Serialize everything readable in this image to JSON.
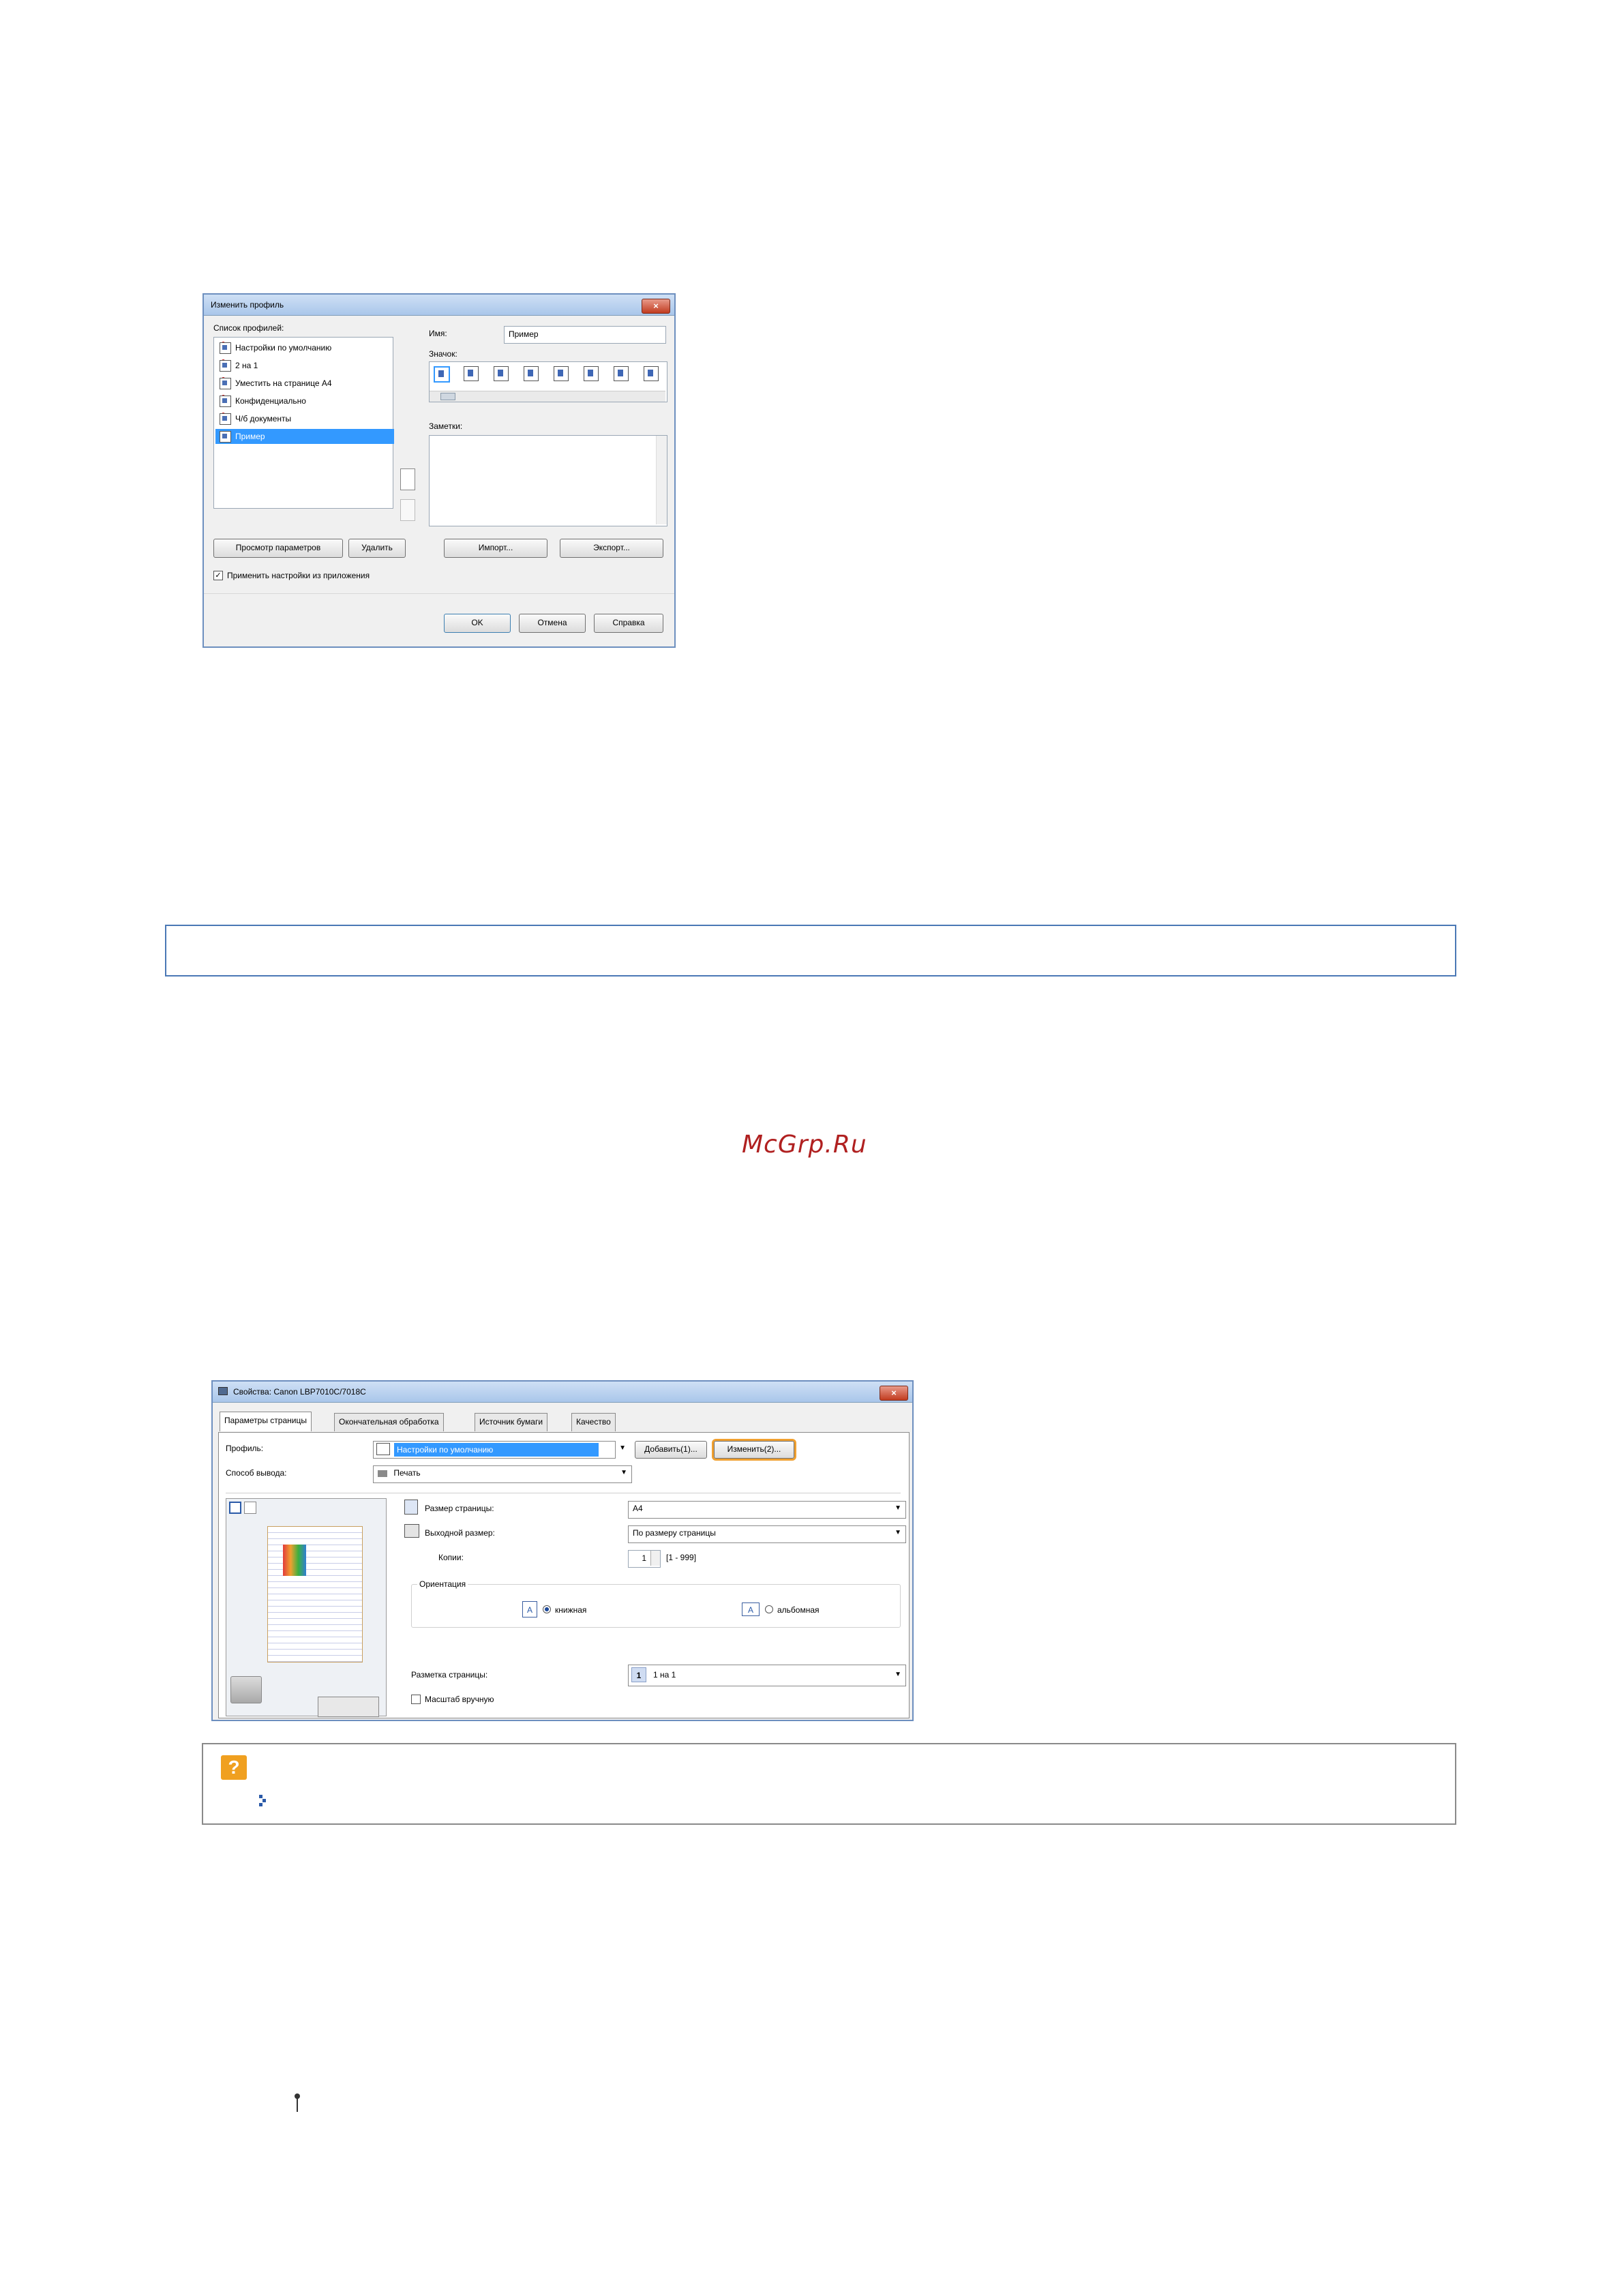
{
  "dialog1": {
    "title": "Изменить профиль",
    "close": "×",
    "profile_list_label": "Список профилей:",
    "profiles": [
      "Настройки по умолчанию",
      "2 на 1",
      "Уместить на странице A4",
      "Конфиденциально",
      "Ч/б документы",
      "Пример"
    ],
    "name_label": "Имя:",
    "name_value": "Пример",
    "icon_label": "Значок:",
    "notes_label": "Заметки:",
    "btn_view": "Просмотр параметров",
    "btn_delete": "Удалить",
    "btn_import": "Импорт...",
    "btn_export": "Экспорт...",
    "apply_checkbox": "Применить настройки из приложения",
    "btn_ok": "OK",
    "btn_cancel": "Отмена",
    "btn_help": "Справка"
  },
  "watermark": "McGrp.Ru",
  "dialog2": {
    "title": "Свойства: Canon LBP7010C/7018C",
    "close": "×",
    "tabs": [
      "Параметры страницы",
      "Окончательная обработка",
      "Источник бумаги",
      "Качество"
    ],
    "profile_label": "Профиль:",
    "profile_value": "Настройки по умолчанию",
    "btn_add": "Добавить(1)...",
    "btn_edit": "Изменить(2)...",
    "output_label": "Способ вывода:",
    "output_value": "Печать",
    "page_size_label": "Размер страницы:",
    "page_size_value": "A4",
    "output_size_label": "Выходной размер:",
    "output_size_value": "По размеру страницы",
    "copies_label": "Копии:",
    "copies_value": "1",
    "copies_range": "[1 - 999]",
    "orientation_label": "Ориентация",
    "portrait_label": "книжная",
    "landscape_label": "альбомная",
    "layout_label": "Разметка страницы:",
    "layout_number": "1",
    "layout_value": "1 на 1",
    "manual_scale_label": "Масштаб вручную"
  },
  "note": {
    "icon": "?"
  },
  "colors": {
    "box_border": "#4a78b5",
    "highlight": "#f0a030",
    "watermark": "#b02020"
  }
}
